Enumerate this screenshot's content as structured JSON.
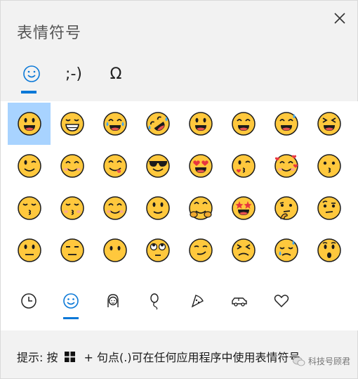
{
  "title": "表情符号",
  "close_label": "×",
  "top_tabs": [
    {
      "name": "emoji",
      "label": "☺",
      "active": true
    },
    {
      "name": "kaomoji",
      "label": ";-)",
      "active": false
    },
    {
      "name": "symbols",
      "label": "Ω",
      "active": false
    }
  ],
  "emojis": [
    "grinning",
    "grin",
    "joy",
    "rofl",
    "smiley",
    "smile",
    "sweat-smile",
    "laughing",
    "wink",
    "blush",
    "yum",
    "sunglasses",
    "heart-eyes",
    "kissing-heart",
    "smiling-hearts",
    "kissing",
    "kissing-smiling",
    "kissing-closed-eyes",
    "relaxed",
    "slightly-smiling",
    "hugging",
    "star-struck",
    "thinking",
    "raised-eyebrow",
    "neutral",
    "expressionless",
    "no-mouth",
    "rolling-eyes",
    "smirk",
    "persevere",
    "disappointed-relieved",
    "hushed"
  ],
  "category_tabs": [
    {
      "name": "recent",
      "icon": "clock-icon",
      "active": false
    },
    {
      "name": "smileys",
      "icon": "smiley-outline-icon",
      "active": true
    },
    {
      "name": "people",
      "icon": "person-icon",
      "active": false
    },
    {
      "name": "celebration",
      "icon": "balloon-icon",
      "active": false
    },
    {
      "name": "food",
      "icon": "pizza-icon",
      "active": false
    },
    {
      "name": "travel",
      "icon": "car-icon",
      "active": false
    },
    {
      "name": "symbols",
      "icon": "heart-icon",
      "active": false
    }
  ],
  "hint": {
    "prefix": "提示: 按",
    "suffix": "+ 句点(.)可在任何应用程序中使用表情符号"
  },
  "watermark": "科技号顾君",
  "colors": {
    "accent": "#0a78d7",
    "selected_bg": "#a8d3ff",
    "emoji_face": "#ffc83d"
  }
}
